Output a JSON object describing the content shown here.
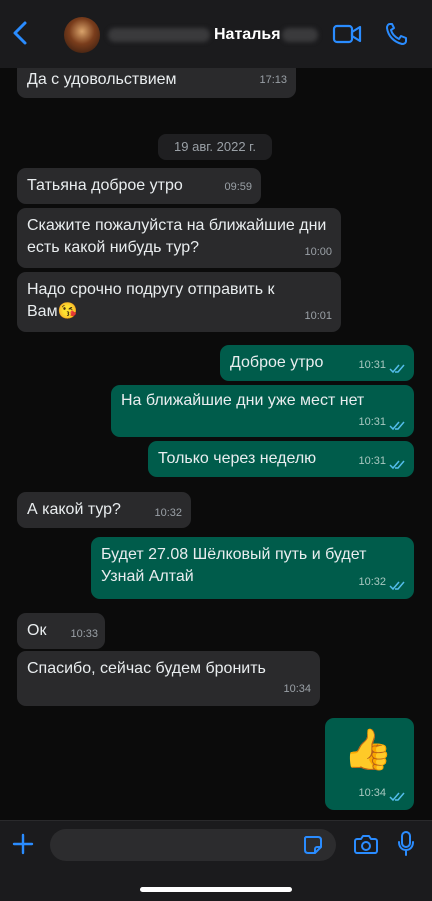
{
  "header": {
    "contact_name": "Наталья"
  },
  "date_separator": "19 авг. 2022 г.",
  "messages": [
    {
      "text": "Да с удовольствием",
      "time": "17:13"
    },
    {
      "text": "Татьяна доброе утро",
      "time": "09:59"
    },
    {
      "text": "Скажите пожалуйста на ближайшие дни есть какой нибудь тур?",
      "time": "10:00"
    },
    {
      "text": "Надо срочно подругу отправить к Вам😘",
      "time": "10:01"
    },
    {
      "text": "Доброе утро",
      "time": "10:31"
    },
    {
      "text": "На ближайшие дни уже мест нет",
      "time": "10:31"
    },
    {
      "text": "Только через неделю",
      "time": "10:31"
    },
    {
      "text": "А какой тур?",
      "time": "10:32"
    },
    {
      "text": "Будет 27.08 Шёлковый путь и будет Узнай Алтай",
      "time": "10:32"
    },
    {
      "text": "Ок",
      "time": "10:33"
    },
    {
      "text": "Спасибо, сейчас будем бронить",
      "time": "10:34"
    },
    {
      "text": "👍",
      "time": "10:34"
    }
  ],
  "colors": {
    "accent": "#2a8cff",
    "outgoing_bubble": "#005c4b",
    "incoming_bubble": "#2a2a2c"
  },
  "icons": [
    "back-arrow-icon",
    "video-call-icon",
    "phone-icon",
    "plus-icon",
    "sticker-icon",
    "camera-icon",
    "mic-icon",
    "read-ticks-icon"
  ]
}
